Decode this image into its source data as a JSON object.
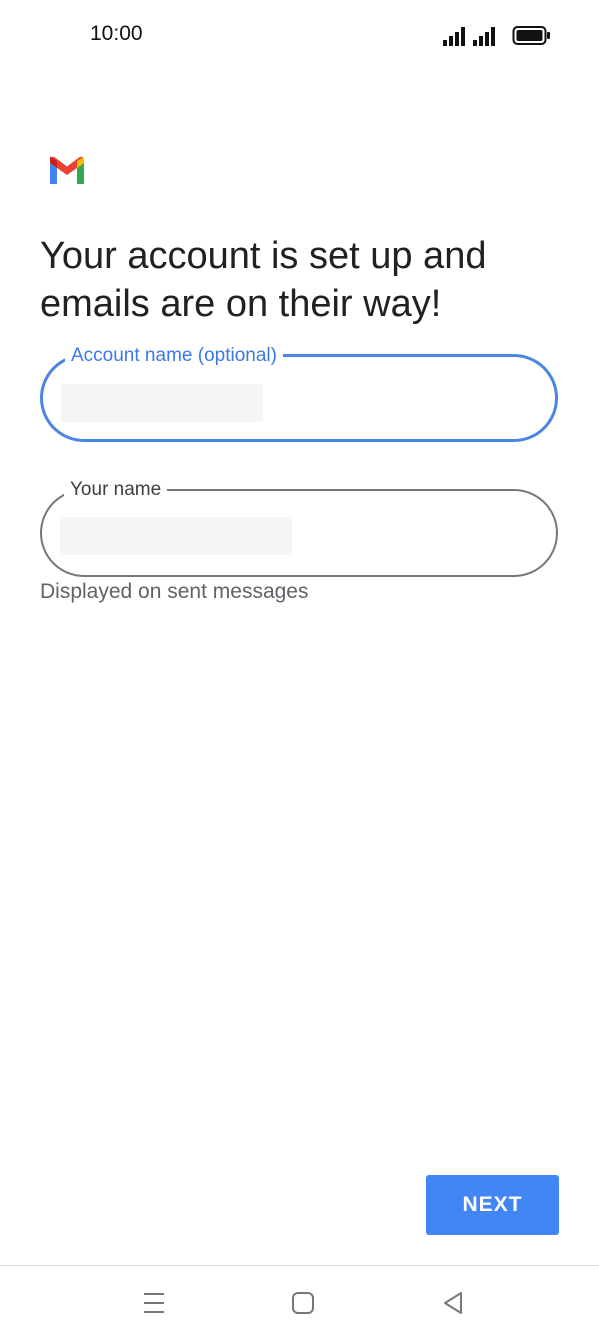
{
  "status_bar": {
    "time": "10:00",
    "icons": [
      "signal-icon",
      "signal-icon",
      "battery-icon"
    ]
  },
  "logo": {
    "icon": "gmail-logo-icon",
    "colors": {
      "blue": "#4285F4",
      "red": "#EA4335",
      "yellow": "#FBBC04",
      "green": "#34A853"
    }
  },
  "headline": "Your account is set up and emails are on their way!",
  "form": {
    "account_name": {
      "label": "Account name (optional)",
      "value": ""
    },
    "your_name": {
      "label": "Your name",
      "value": "",
      "helper": "Displayed on sent messages"
    }
  },
  "actions": {
    "next_label": "NEXT"
  },
  "nav_bar": {
    "icons": [
      "menu-icon",
      "home-icon",
      "back-icon"
    ]
  },
  "colors": {
    "accent": "#4285F4",
    "focused_border": "#4A86E1",
    "text_primary": "#202124",
    "text_secondary": "#5F6368"
  }
}
